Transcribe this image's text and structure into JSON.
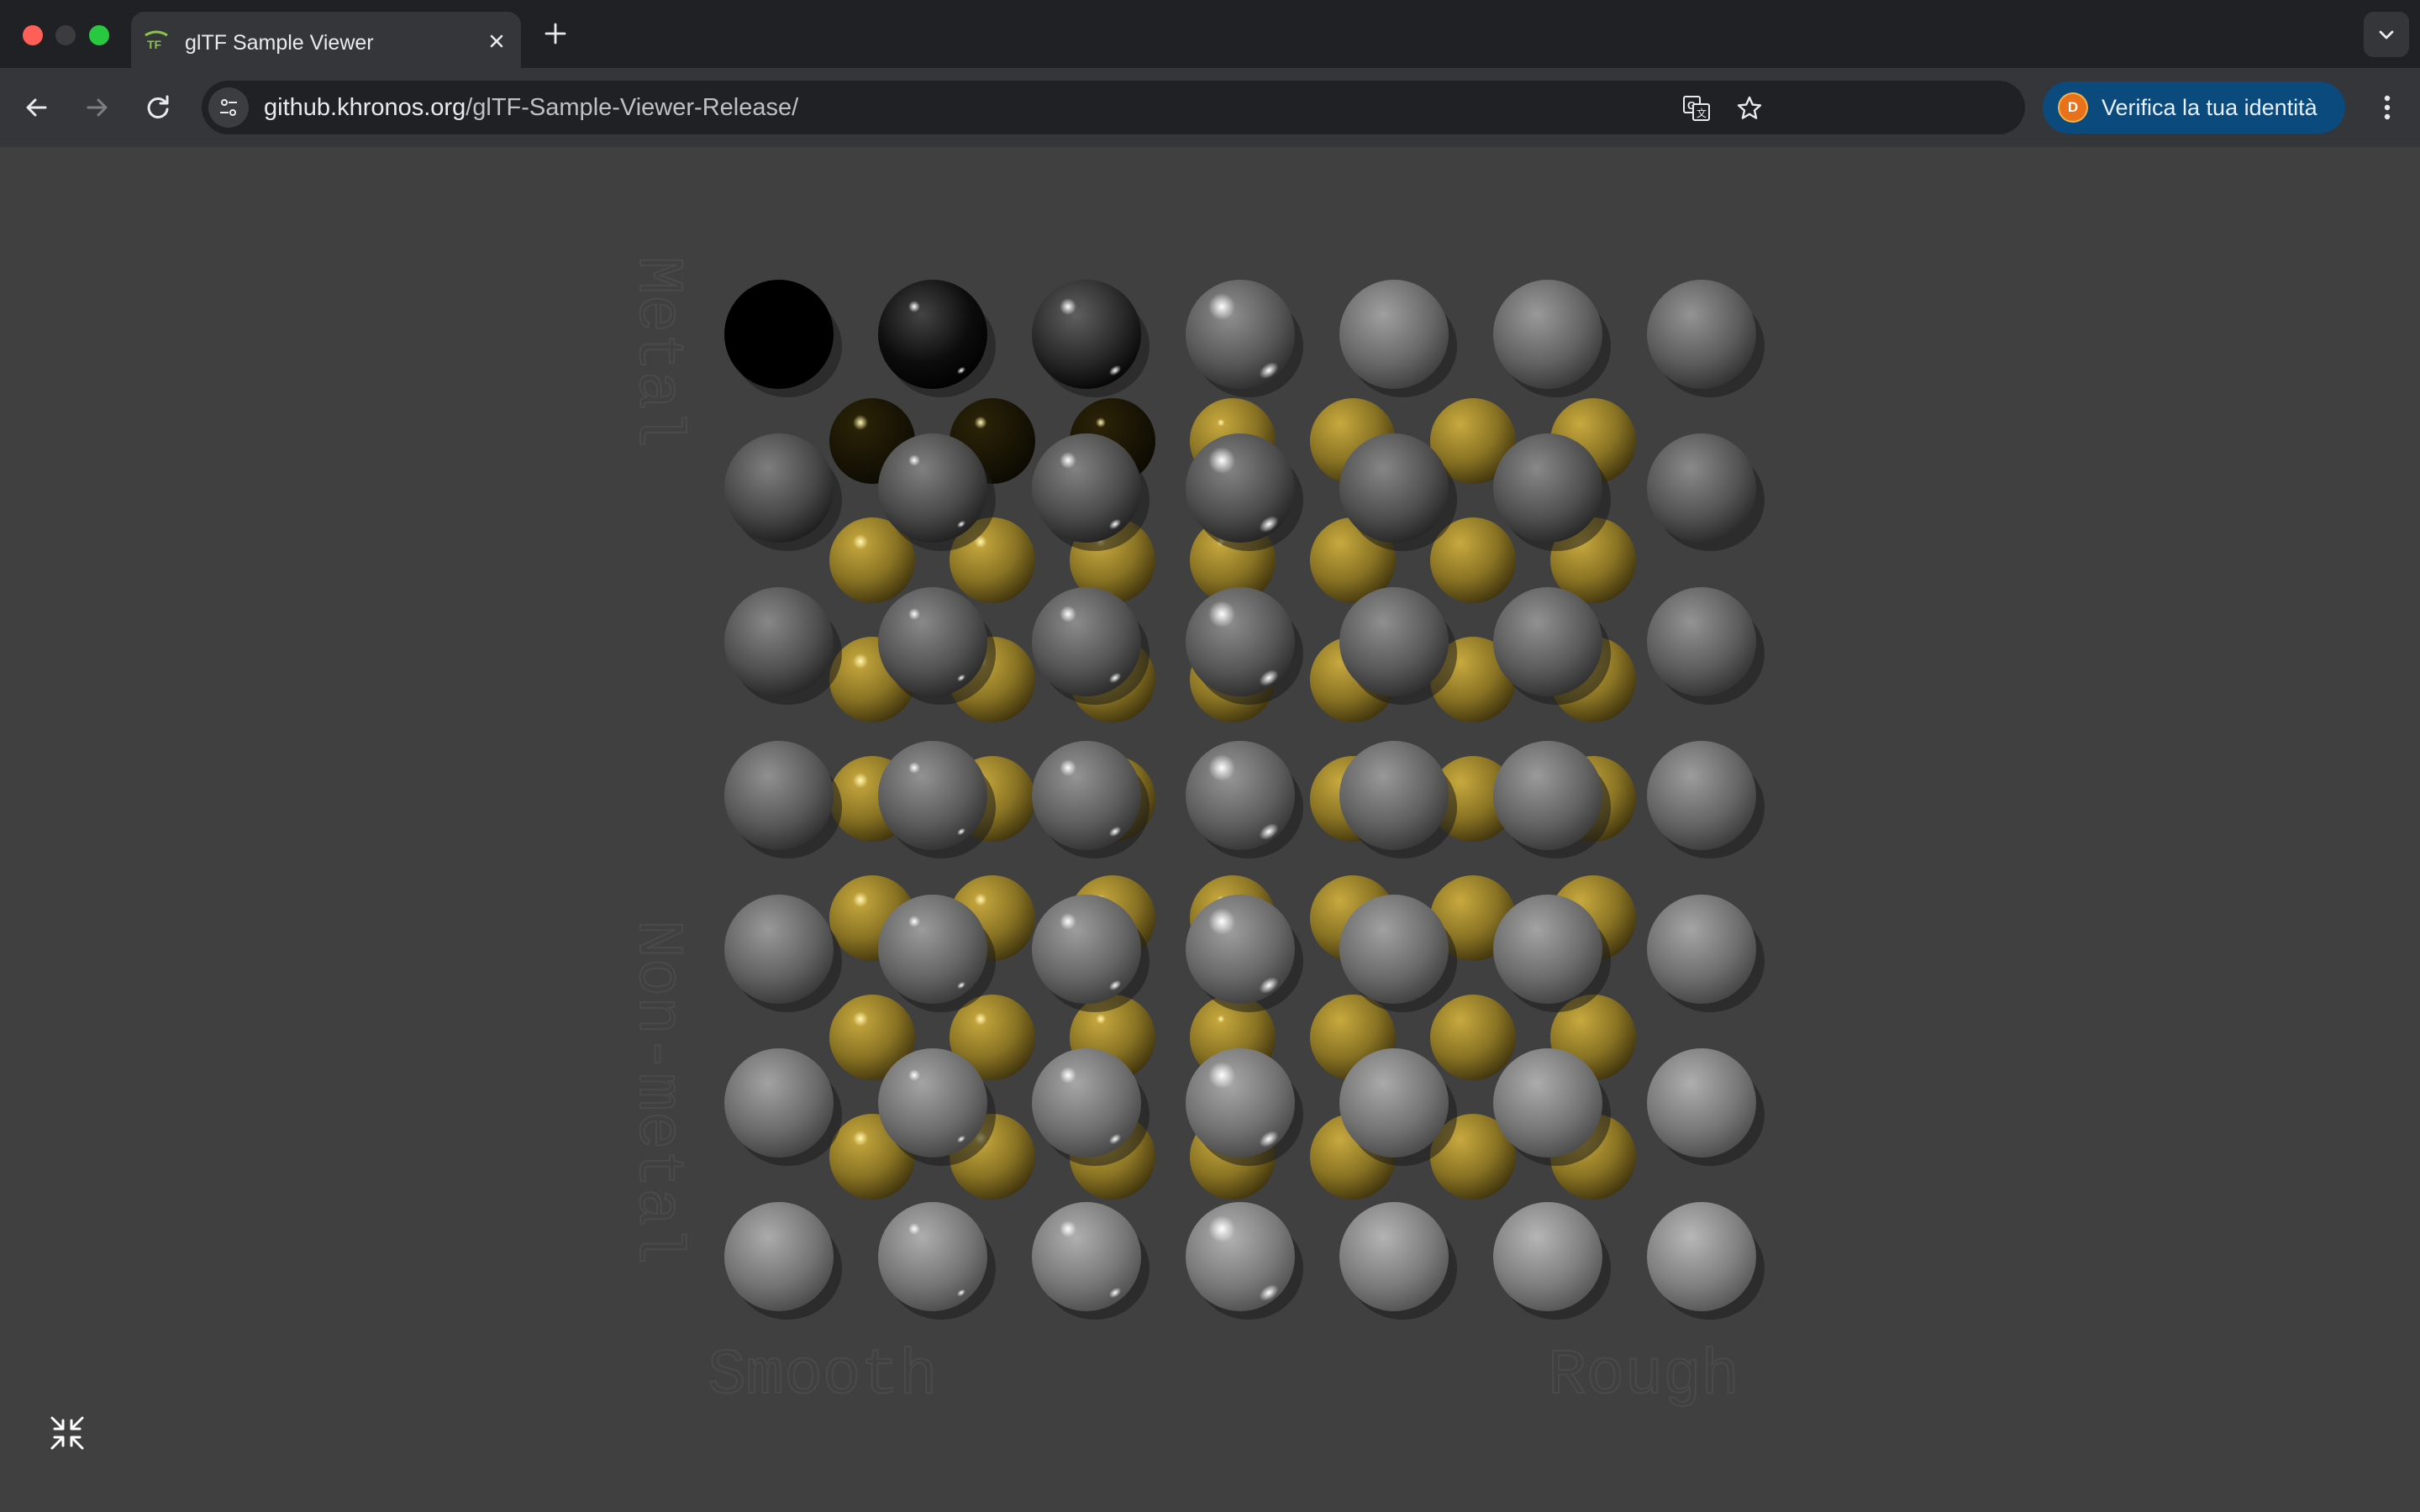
{
  "browser": {
    "tab": {
      "title": "glTF Sample Viewer",
      "favicon": "gltf-logo-icon"
    },
    "address_bar": {
      "host": "github.khronos.org",
      "path": "/glTF-Sample-Viewer-Release/"
    },
    "profile_button": {
      "avatar_letter": "D",
      "label": "Verifica la tua identità"
    },
    "icons": {
      "back": "arrow-left-icon",
      "forward": "arrow-right-icon",
      "reload": "reload-icon",
      "site_info": "tune-icon",
      "translate": "translate-icon",
      "bookmark": "star-icon",
      "menu": "kebab-menu-icon",
      "new_tab": "plus-icon",
      "tab_search": "chevron-down-icon"
    }
  },
  "viewer": {
    "labels": {
      "metal": "Metal",
      "non_metal": "Non-metal",
      "smooth": "Smooth",
      "rough": "Rough"
    },
    "background_color": "#404040",
    "sphere_grid": {
      "rows": 7,
      "columns": 7
    },
    "gold_grid": {
      "rows": 7,
      "columns": 7
    },
    "colors": {
      "grey_sphere": "#707070",
      "gold_sphere": "#b59a3a"
    },
    "controls": {
      "exit_fullscreen": "exit-fullscreen-icon"
    }
  }
}
